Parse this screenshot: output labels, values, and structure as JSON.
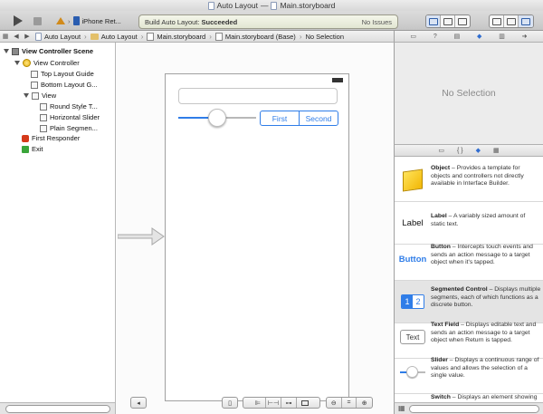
{
  "window": {
    "project": "Auto Layout",
    "separator": "—",
    "file": "Main.storyboard"
  },
  "toolbar": {
    "scheme_label": "iPhone Ret...",
    "activity_prefix": "Build Auto Layout: ",
    "activity_status": "Succeeded",
    "issues": "No Issues"
  },
  "jumpbar": {
    "crumbs": [
      "Auto Layout",
      "Auto Layout",
      "Main.storyboard",
      "Main.storyboard (Base)",
      "No Selection"
    ]
  },
  "outline": {
    "items": [
      {
        "label": "View Controller Scene"
      },
      {
        "label": "View Controller"
      },
      {
        "label": "Top Layout Guide"
      },
      {
        "label": "Bottom Layout G..."
      },
      {
        "label": "View"
      },
      {
        "label": "Round Style T..."
      },
      {
        "label": "Horizontal Slider"
      },
      {
        "label": "Plain Segmen..."
      },
      {
        "label": "First Responder"
      },
      {
        "label": "Exit"
      }
    ]
  },
  "canvas": {
    "segments": [
      "First",
      "Second"
    ],
    "slider_value": 0.5
  },
  "inspector": {
    "empty_text": "No Selection"
  },
  "library": {
    "items": [
      {
        "title": "Object",
        "desc": " – Provides a template for objects and controllers not directly available in Interface Builder.",
        "icon_label": ""
      },
      {
        "title": "Label",
        "desc": " – A variably sized amount of static text.",
        "icon_label": "Label"
      },
      {
        "title": "Button",
        "desc": " – Intercepts touch events and sends an action message to a target object when it's tapped.",
        "icon_label": "Button"
      },
      {
        "title": "Segmented Control",
        "desc": " – Displays multiple segments, each of which functions as a discrete button.",
        "icon_label": ""
      },
      {
        "title": "Text Field",
        "desc": " – Displays editable text and sends an action message to a target object when Return is tapped.",
        "icon_label": "Text"
      },
      {
        "title": "Slider",
        "desc": " – Displays a continuous range of values and allows the selection of a single value.",
        "icon_label": ""
      },
      {
        "title": "Switch",
        "desc": " – Displays an element showing the boolean state of a value.",
        "icon_label": ""
      }
    ],
    "segment_icon_labels": [
      "1",
      "2"
    ]
  },
  "colors": {
    "accent": "#2f7de8",
    "selected_row": "#e4e4e4",
    "switch_on": "#4cd964"
  }
}
